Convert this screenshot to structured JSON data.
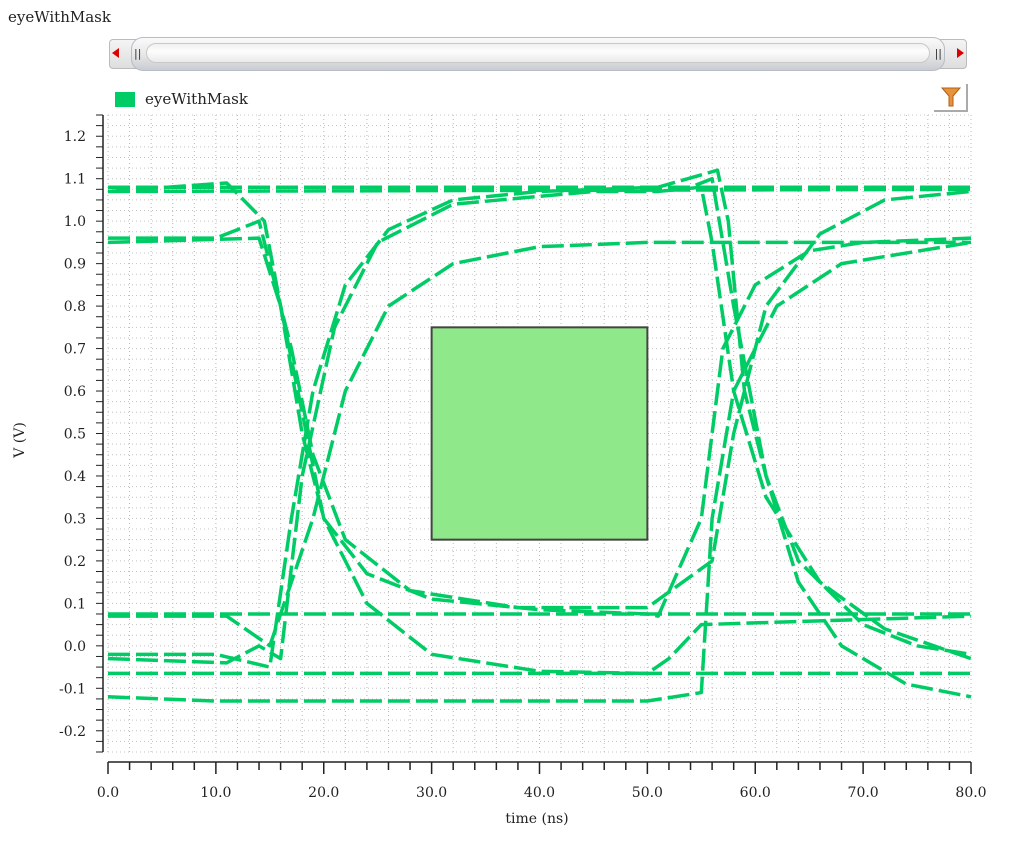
{
  "title": "eyeWithMask",
  "legend": {
    "label": "eyeWithMask",
    "color": "#00cc66"
  },
  "icons": {
    "filter": "filter-funnel-icon",
    "scroll_left": "arrow-left-icon",
    "scroll_right": "arrow-right-icon"
  },
  "chart_data": {
    "type": "line",
    "title": "eyeWithMask",
    "xlabel": "time (ns)",
    "ylabel": "V (V)",
    "xlim": [
      0,
      80
    ],
    "ylim": [
      -0.25,
      1.25
    ],
    "xticks": [
      "0.0",
      "10.0",
      "20.0",
      "30.0",
      "40.0",
      "50.0",
      "60.0",
      "70.0",
      "80.0"
    ],
    "yticks": [
      "1.2",
      "1.1",
      "1.0",
      "0.9",
      "0.8",
      "0.7",
      "0.6",
      "0.5",
      "0.4",
      "0.3",
      "0.2",
      "0.1",
      "0.0",
      "-0.1",
      "-0.2"
    ],
    "grid": true,
    "series_color": "#00cc66",
    "mask": {
      "t_start": 30,
      "t_end": 50,
      "v_low": 0.25,
      "v_high": 0.75,
      "fill": "#8fe88a",
      "stroke": "#444444"
    },
    "series": [
      {
        "name": "eyeWithMask",
        "points": [
          [
            0,
            1.08
          ],
          [
            80,
            1.08
          ]
        ]
      },
      {
        "name": "eyeWithMask",
        "points": [
          [
            0,
            1.07
          ],
          [
            80,
            1.075
          ]
        ]
      },
      {
        "name": "eyeWithMask",
        "points": [
          [
            0,
            0.075
          ],
          [
            80,
            0.075
          ]
        ]
      },
      {
        "name": "eyeWithMask",
        "points": [
          [
            0,
            -0.065
          ],
          [
            80,
            -0.065
          ]
        ]
      },
      {
        "name": "eyeWithMask",
        "points": [
          [
            0,
            1.07
          ],
          [
            11,
            1.09
          ],
          [
            14.5,
            1.0
          ],
          [
            16,
            0.8
          ],
          [
            18,
            0.5
          ],
          [
            20,
            0.3
          ],
          [
            24,
            0.17
          ],
          [
            30,
            0.11
          ],
          [
            40,
            0.085
          ],
          [
            50,
            0.075
          ],
          [
            51,
            0.07
          ],
          [
            55,
            0.3
          ],
          [
            57,
            0.7
          ],
          [
            60,
            0.85
          ],
          [
            65,
            0.93
          ],
          [
            70,
            0.95
          ],
          [
            80,
            0.96
          ]
        ]
      },
      {
        "name": "eyeWithMask",
        "points": [
          [
            0,
            0.96
          ],
          [
            10,
            0.96
          ],
          [
            14,
            1.0
          ],
          [
            17,
            0.7
          ],
          [
            19,
            0.45
          ],
          [
            22,
            0.25
          ],
          [
            28,
            0.13
          ],
          [
            38,
            0.09
          ],
          [
            50,
            0.09
          ],
          [
            56,
            0.2
          ],
          [
            58,
            0.5
          ],
          [
            61,
            0.8
          ],
          [
            66,
            0.97
          ],
          [
            72,
            1.05
          ],
          [
            80,
            1.07
          ]
        ]
      },
      {
        "name": "eyeWithMask",
        "points": [
          [
            0,
            -0.02
          ],
          [
            10,
            -0.02
          ],
          [
            15,
            -0.05
          ],
          [
            17,
            0.3
          ],
          [
            19,
            0.6
          ],
          [
            22,
            0.85
          ],
          [
            26,
            0.98
          ],
          [
            32,
            1.05
          ],
          [
            40,
            1.07
          ],
          [
            51,
            1.08
          ],
          [
            56.5,
            1.12
          ],
          [
            57.5,
            1.0
          ],
          [
            59,
            0.6
          ],
          [
            61,
            0.4
          ],
          [
            64,
            0.2
          ],
          [
            70,
            0.05
          ],
          [
            75,
            0.0
          ],
          [
            80,
            -0.02
          ]
        ]
      },
      {
        "name": "eyeWithMask",
        "points": [
          [
            0,
            -0.03
          ],
          [
            11,
            -0.04
          ],
          [
            14,
            0.0
          ],
          [
            16,
            -0.03
          ],
          [
            18,
            0.4
          ],
          [
            21,
            0.75
          ],
          [
            25,
            0.95
          ],
          [
            32,
            1.04
          ],
          [
            45,
            1.07
          ],
          [
            51,
            1.07
          ],
          [
            55,
            1.08
          ],
          [
            56,
            0.95
          ],
          [
            58,
            0.6
          ],
          [
            61,
            0.35
          ],
          [
            66,
            0.15
          ],
          [
            72,
            0.04
          ],
          [
            80,
            -0.03
          ]
        ]
      },
      {
        "name": "eyeWithMask",
        "points": [
          [
            0,
            -0.12
          ],
          [
            10,
            -0.13
          ],
          [
            50,
            -0.13
          ],
          [
            55,
            -0.11
          ],
          [
            56,
            0.3
          ],
          [
            58,
            0.6
          ],
          [
            62,
            0.8
          ],
          [
            68,
            0.9
          ],
          [
            80,
            0.95
          ]
        ]
      },
      {
        "name": "eyeWithMask",
        "points": [
          [
            0,
            0.95
          ],
          [
            14,
            0.96
          ],
          [
            16,
            0.8
          ],
          [
            18,
            0.55
          ],
          [
            20,
            0.3
          ],
          [
            24,
            0.1
          ],
          [
            30,
            -0.02
          ],
          [
            40,
            -0.06
          ],
          [
            50,
            -0.065
          ],
          [
            52,
            -0.03
          ],
          [
            55,
            0.05
          ],
          [
            80,
            0.07
          ]
        ]
      },
      {
        "name": "eyeWithMask",
        "points": [
          [
            0,
            0.07
          ],
          [
            11,
            0.07
          ],
          [
            15,
            0.0
          ],
          [
            19,
            0.3
          ],
          [
            22,
            0.6
          ],
          [
            26,
            0.8
          ],
          [
            32,
            0.9
          ],
          [
            40,
            0.94
          ],
          [
            50,
            0.95
          ],
          [
            80,
            0.95
          ]
        ]
      },
      {
        "name": "eyeWithMask",
        "points": [
          [
            0,
            1.08
          ],
          [
            54,
            1.08
          ],
          [
            56,
            1.1
          ],
          [
            58,
            0.8
          ],
          [
            61,
            0.4
          ],
          [
            64,
            0.15
          ],
          [
            68,
            0.0
          ],
          [
            74,
            -0.09
          ],
          [
            80,
            -0.12
          ]
        ]
      }
    ]
  }
}
